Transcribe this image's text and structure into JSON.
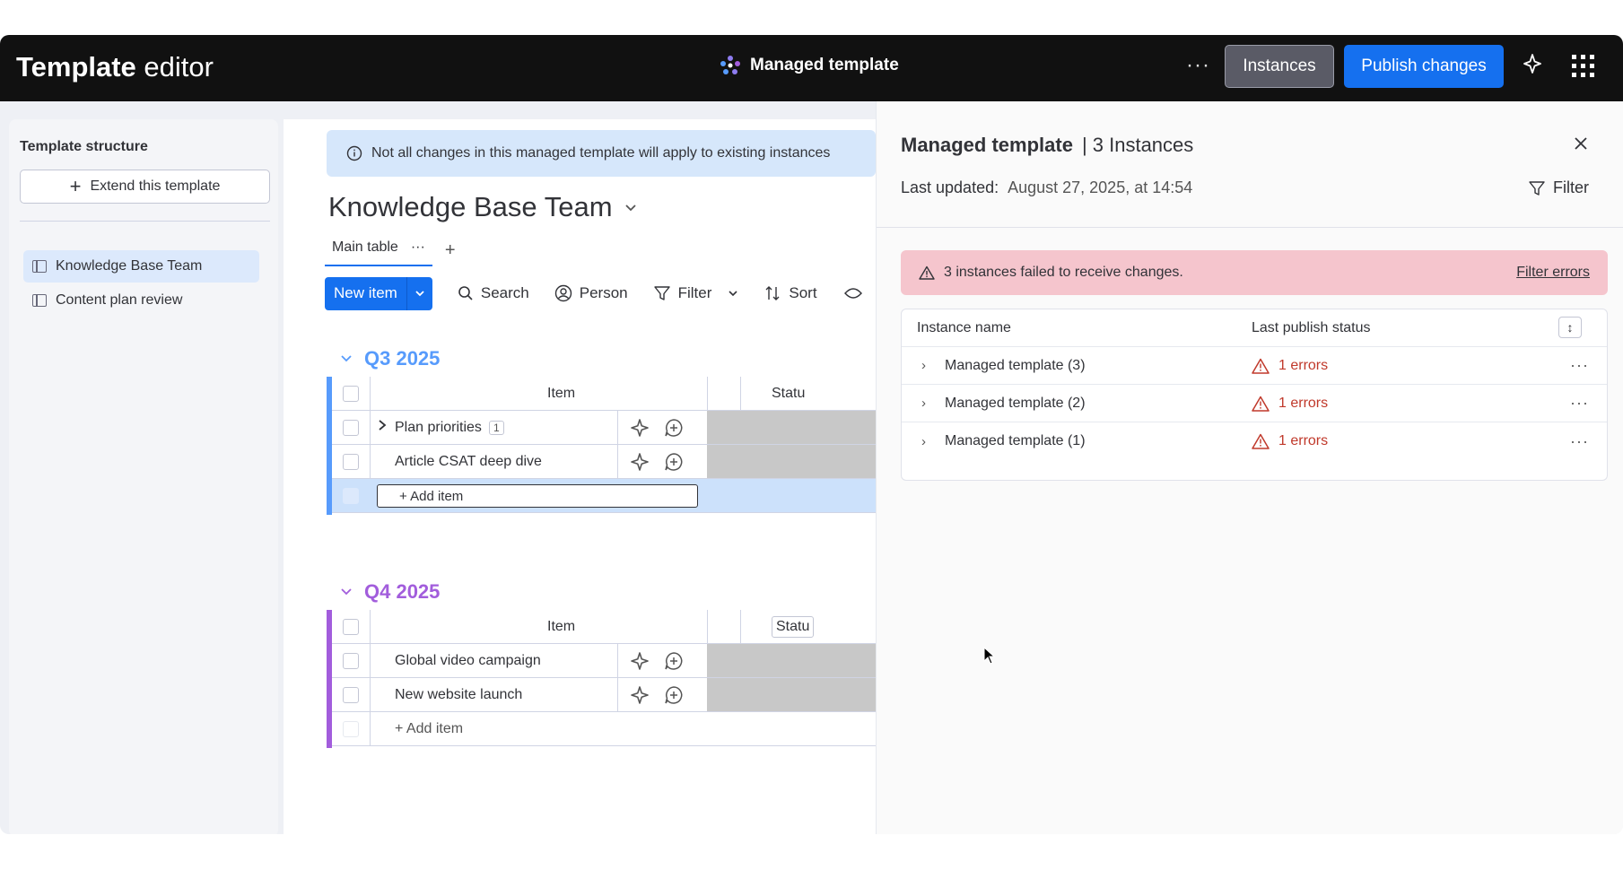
{
  "topbar": {
    "title_bold": "Template",
    "title_light": "editor",
    "center_title": "Managed template",
    "instances_label": "Instances",
    "publish_label": "Publish changes",
    "more_label": "···"
  },
  "sidebar": {
    "title": "Template structure",
    "extend_label": "Extend this template",
    "items": [
      {
        "label": "Knowledge Base Team",
        "active": true
      },
      {
        "label": "Content plan review",
        "active": false
      }
    ]
  },
  "board": {
    "notice": "Not all changes in this managed template will apply to existing instances",
    "title": "Knowledge Base Team",
    "tab_main": "Main table",
    "tab_more": "···",
    "tab_add": "+",
    "toolbar": {
      "new_item": "New item",
      "search": "Search",
      "person": "Person",
      "filter": "Filter",
      "sort": "Sort"
    },
    "groups": [
      {
        "title": "Q3 2025",
        "color": "#579bfc",
        "header_item": "Item",
        "header_status": "Statu",
        "rows": [
          {
            "name": "Plan priorities",
            "count": "1"
          },
          {
            "name": "Article CSAT deep dive",
            "count": ""
          }
        ],
        "add_item": "+ Add item"
      },
      {
        "title": "Q4 2025",
        "color": "#a25ddc",
        "header_item": "Item",
        "header_status": "Statu",
        "rows": [
          {
            "name": "Global video campaign",
            "count": ""
          },
          {
            "name": "New website launch",
            "count": ""
          }
        ],
        "add_item": "+ Add item"
      }
    ]
  },
  "panel": {
    "title": "Managed template",
    "instances_count": "| 3 Instances",
    "updated_label": "Last updated:",
    "updated_value": "August 27, 2025, at 14:54",
    "filter_label": "Filter",
    "alert_text": "3 instances failed to receive changes.",
    "alert_link": "Filter errors",
    "table": {
      "col_name": "Instance name",
      "col_status": "Last publish status",
      "rows": [
        {
          "name": "Managed template (3)",
          "status": "1 errors"
        },
        {
          "name": "Managed template (2)",
          "status": "1 errors"
        },
        {
          "name": "Managed template (1)",
          "status": "1 errors"
        }
      ]
    }
  },
  "colors": {
    "accent": "#1570ef",
    "error": "#c0392b",
    "alert_bg": "#f5c5cd",
    "notice_bg": "#d6e7fb"
  }
}
